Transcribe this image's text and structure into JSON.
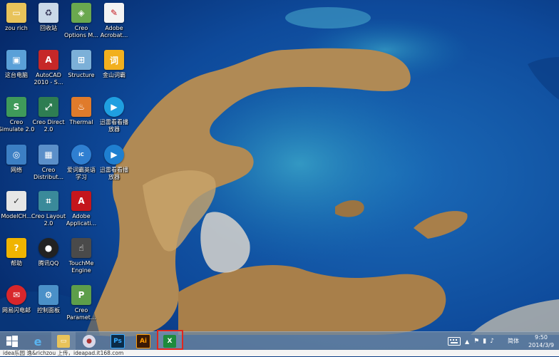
{
  "desktop": {
    "icons": [
      {
        "label": "zou rich",
        "icon": "folder-icon"
      },
      {
        "label": "回收站",
        "icon": "recycle-bin-icon"
      },
      {
        "label": "Creo\nOptions M...",
        "icon": "creo-options-icon"
      },
      {
        "label": "Adobe\nAcrobat...",
        "icon": "adobe-acrobat-icon"
      },
      {
        "label": "这台电脑",
        "icon": "computer-icon"
      },
      {
        "label": "AutoCAD\n2010 - S...",
        "icon": "autocad-icon"
      },
      {
        "label": "Structure",
        "icon": "structure-icon"
      },
      {
        "label": "金山词霸",
        "icon": "kingsoft-dict-icon"
      },
      {
        "label": "Creo\nSimulate 2.0",
        "icon": "creo-simulate-icon"
      },
      {
        "label": "Creo Direct\n2.0",
        "icon": "creo-direct-icon"
      },
      {
        "label": "Thermal",
        "icon": "thermal-icon"
      },
      {
        "label": "迅雷看看播\n放器",
        "icon": "xunlei-player-icon"
      },
      {
        "label": "网络",
        "icon": "network-icon"
      },
      {
        "label": "Creo\nDistribut...",
        "icon": "creo-distributed-icon"
      },
      {
        "label": "爱词霸英语\n学习",
        "icon": "iciba-icon"
      },
      {
        "label": "迅雷看看播\n放器",
        "icon": "xunlei-player-icon"
      },
      {
        "label": "ModelCH...",
        "icon": "modelcheck-icon"
      },
      {
        "label": "Creo Layout\n2.0",
        "icon": "creo-layout-icon"
      },
      {
        "label": "Adobe\nApplicati...",
        "icon": "adobe-application-icon"
      },
      {
        "label": "帮助",
        "icon": "help-icon"
      },
      {
        "label": "腾讯QQ",
        "icon": "qq-icon"
      },
      {
        "label": "TouchMe\nEngine",
        "icon": "touchme-icon"
      },
      {
        "label": "网易闪电邮",
        "icon": "netease-mail-icon"
      },
      {
        "label": "控制面板",
        "icon": "control-panel-icon"
      },
      {
        "label": "Creo\nParamet...",
        "icon": "creo-parametric-icon"
      }
    ]
  },
  "taskbar": {
    "buttons": [
      {
        "icon": "start-windows-icon"
      },
      {
        "icon": "internet-explorer-icon"
      },
      {
        "icon": "file-explorer-icon"
      },
      {
        "icon": "app-globe-icon"
      },
      {
        "icon": "photoshop-icon",
        "text": "Ps"
      },
      {
        "icon": "illustrator-icon",
        "text": "Ai"
      },
      {
        "icon": "excel-icon",
        "text": "X"
      }
    ],
    "ime": "简体",
    "clock": {
      "time": "9:50",
      "date": "2014/3/9"
    }
  },
  "watermark": "idea乐园 逸&richzou 上传，ideapad.it168.com",
  "colors": {
    "highlight": "#e0261d",
    "taskbar": "#6e87a0"
  }
}
